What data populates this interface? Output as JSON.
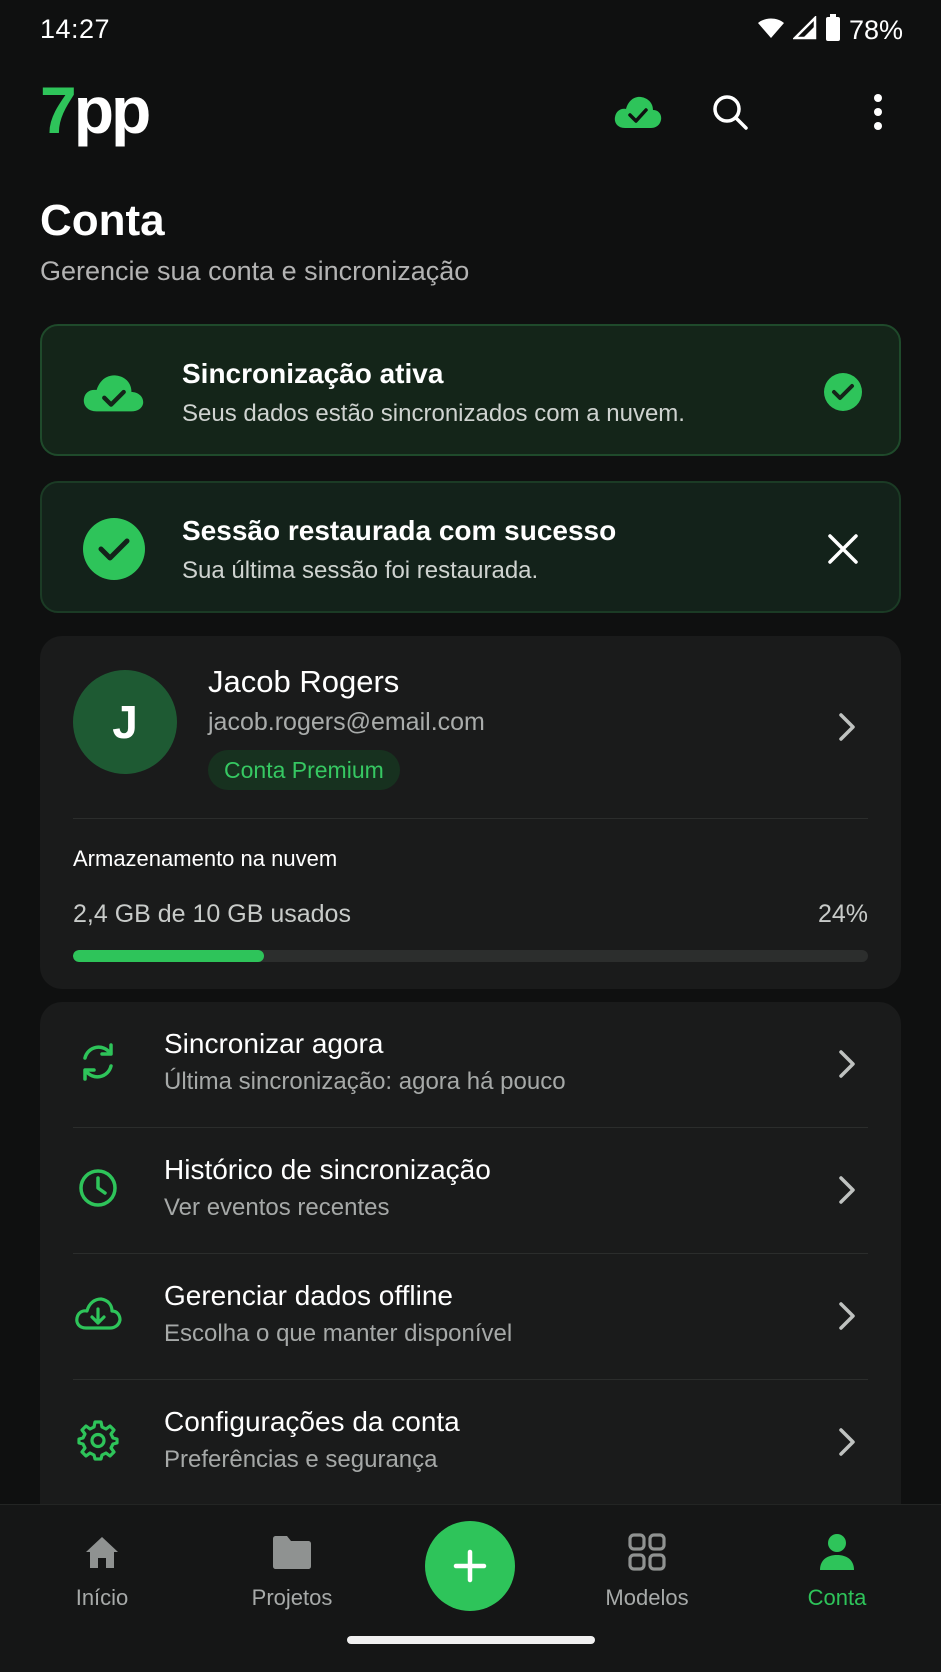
{
  "status_bar": {
    "time": "14:27",
    "battery": "78%"
  },
  "app_bar": {
    "logo_seven": "7",
    "logo_pp": "pp"
  },
  "header": {
    "title": "Conta",
    "subtitle": "Gerencie sua conta e sincronização"
  },
  "sync_banner": {
    "title": "Sincronização ativa",
    "subtitle": "Seus dados estão sincronizados com a nuvem."
  },
  "session_banner": {
    "title": "Sessão restaurada com sucesso",
    "subtitle": "Sua última sessão foi restaurada."
  },
  "profile": {
    "initial": "J",
    "name": "Jacob Rogers",
    "email": "jacob.rogers@email.com",
    "badge": "Conta Premium"
  },
  "storage": {
    "title": "Armazenamento na nuvem",
    "used_text": "2,4 GB de 10 GB usados",
    "percent_text": "24%",
    "fraction": 0.24
  },
  "menu": [
    {
      "title": "Sincronizar agora",
      "subtitle": "Última sincronização: agora há pouco",
      "icon": "sync-icon"
    },
    {
      "title": "Histórico de sincronização",
      "subtitle": "Ver eventos recentes",
      "icon": "clock-icon"
    },
    {
      "title": "Gerenciar dados offline",
      "subtitle": "Escolha o que manter disponível",
      "icon": "cloud-download-icon"
    },
    {
      "title": "Configurações da conta",
      "subtitle": "Preferências e segurança",
      "icon": "gear-icon"
    }
  ],
  "bottom_nav": {
    "home": "Início",
    "projects": "Projetos",
    "models": "Modelos",
    "account": "Conta"
  },
  "colors": {
    "accent": "#2ec45a",
    "background": "#0f1010",
    "card": "#1a1b1b"
  }
}
